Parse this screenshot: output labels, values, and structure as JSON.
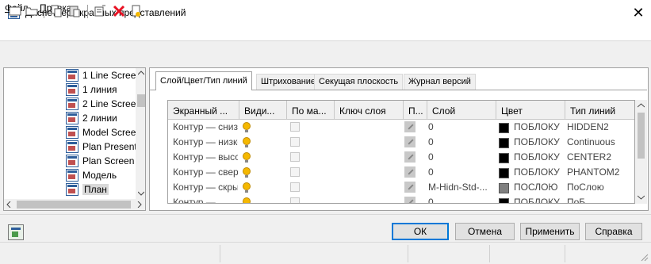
{
  "window": {
    "title": "Диспетчер экранных представлений",
    "close_glyph": "✕"
  },
  "menu": [
    {
      "label": "Файл",
      "hotkey": "Ф",
      "rest": "айл"
    },
    {
      "label": "Правка",
      "hotkey": "П",
      "rest": "равка"
    }
  ],
  "toolbar_icons": [
    "new-icon",
    "open-icon",
    "copy-icon",
    "paste-icon",
    "import-icon",
    "delete-icon",
    "properties-icon"
  ],
  "tree": {
    "items": [
      {
        "label": "1 Line Scree"
      },
      {
        "label": "1 линия"
      },
      {
        "label": "2 Line Scree"
      },
      {
        "label": "2 линии"
      },
      {
        "label": "Model Scree"
      },
      {
        "label": "Plan Present"
      },
      {
        "label": "Plan Screen"
      },
      {
        "label": "Модель"
      },
      {
        "label": "План",
        "selected": true
      }
    ]
  },
  "tabs": [
    {
      "label": "Слой/Цвет/Тип линий",
      "active": true
    },
    {
      "label": "Штрихование"
    },
    {
      "label": "Секущая плоскость"
    },
    {
      "label": "Журнал версий"
    }
  ],
  "grid": {
    "columns": [
      "Экранный ...",
      "Види...",
      "По ма...",
      "Ключ слоя",
      "П...",
      "Слой",
      "Цвет",
      "Тип линий"
    ],
    "rows": [
      {
        "name": "Контур — снизу",
        "layer": "0",
        "color": "ПОБЛОКУ",
        "swatch": "#000000",
        "linetype": "HIDDEN2"
      },
      {
        "name": "Контур — низко",
        "layer": "0",
        "color": "ПОБЛОКУ",
        "swatch": "#000000",
        "linetype": "Continuous"
      },
      {
        "name": "Контур — высо",
        "layer": "0",
        "color": "ПОБЛОКУ",
        "swatch": "#000000",
        "linetype": "CENTER2"
      },
      {
        "name": "Контур — сверх",
        "layer": "0",
        "color": "ПОБЛОКУ",
        "swatch": "#000000",
        "linetype": "PHANTOM2"
      },
      {
        "name": "Контур — скры",
        "layer": "M-Hidn-Std-...",
        "color": "ПОСЛОЮ",
        "swatch": "#808080",
        "linetype": "ПоСлою"
      },
      {
        "name": "Контур — ...",
        "layer": "0",
        "color": "ПОБЛОКУ",
        "swatch": "#000000",
        "linetype": "ПоБ..."
      }
    ]
  },
  "buttons": {
    "ok": "ОК",
    "cancel": "Отмена",
    "apply": "Применить",
    "help": "Справка"
  },
  "colors": {
    "accent": "#0078d7",
    "bulb": "#f5b800",
    "delete": "#e81123"
  }
}
